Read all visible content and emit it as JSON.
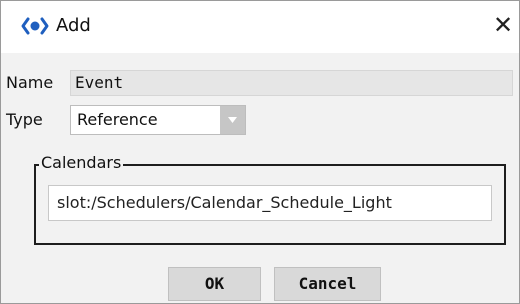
{
  "dialog": {
    "title": "Add",
    "close_glyph": "✕",
    "title_icon": "niagara-component-icon"
  },
  "form": {
    "name_label": "Name",
    "name_value": "Event",
    "type_label": "Type",
    "type_value": "Reference"
  },
  "calendars": {
    "legend": "Calendars",
    "value": "slot:/Schedulers/Calendar_Schedule_Light"
  },
  "buttons": {
    "ok": "OK",
    "cancel": "Cancel"
  },
  "colors": {
    "icon_blue": "#1f5fbf",
    "select_arrow_bg": "#c6c6c6",
    "dialog_bg": "#f2f2f2"
  }
}
